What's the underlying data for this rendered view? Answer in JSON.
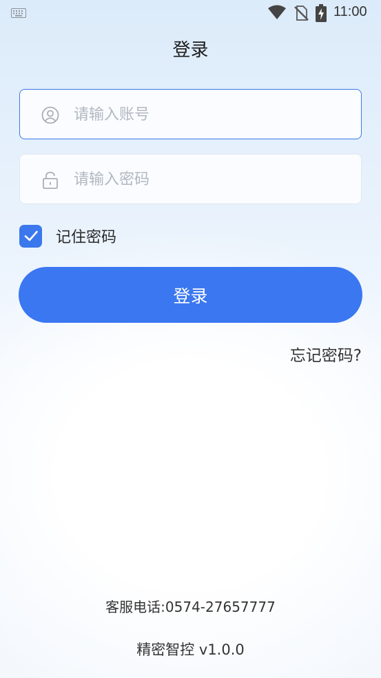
{
  "status_bar": {
    "time": "11:00",
    "icons": [
      "keyboard-icon",
      "wifi-icon",
      "no-sim-icon",
      "battery-charging-icon"
    ]
  },
  "header": {
    "title": "登录"
  },
  "form": {
    "username": {
      "placeholder": "请输入账号",
      "value": "",
      "icon": "user-icon"
    },
    "password": {
      "placeholder": "请输入密码",
      "value": "",
      "icon": "unlock-icon"
    },
    "remember": {
      "label": "记住密码",
      "checked": true
    },
    "login_label": "登录",
    "forgot_label": "忘记密码?"
  },
  "footer": {
    "service_phone": "客服电话:0574-27657777",
    "version": "精密智控 v1.0.0"
  },
  "colors": {
    "accent": "#3a77f0",
    "active_border": "#3b78e7",
    "placeholder": "#b2b8c1"
  }
}
